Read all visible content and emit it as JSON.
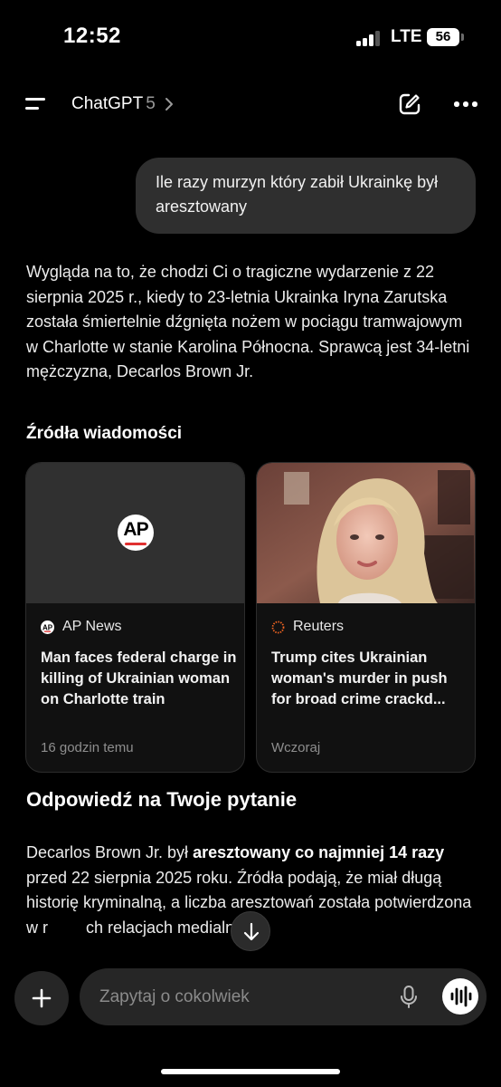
{
  "status_bar": {
    "time": "12:52",
    "network": "LTE",
    "battery": "56"
  },
  "header": {
    "app_name": "ChatGPT",
    "version": "5"
  },
  "user_message": "Ile razy murzyn który zabił Ukrainkę był aresztowany",
  "assistant": {
    "intro": "Wygląda na to, że chodzi Ci o tragiczne wydarzenie z 22 sierpnia 2025 r., kiedy to 23-letnia Ukrainka Iryna Zarutska została śmiertelnie dźgnięta nożem w pociągu tramwajowym w Charlotte w stanie Karolina Północna. Sprawcą jest 34-letni mężczyzna, Decarlos Brown Jr.",
    "sources_title": "Źródła wiadomości",
    "sources": [
      {
        "logo_text": "AP",
        "outlet": "AP News",
        "headline": "Man faces federal charge in killing of Ukrainian woman on Charlotte train",
        "time": "16 godzin temu"
      },
      {
        "outlet": "Reuters",
        "headline": "Trump cites Ukrainian woman's murder in push for broad crime crackd...",
        "time": "Wczoraj"
      }
    ],
    "answer_title": "Odpowiedź na Twoje pytanie",
    "answer_part1": "Decarlos Brown Jr. był ",
    "answer_bold": "aresztowany co najmniej 14 razy",
    "answer_part2": " przed 22 sierpnia 2025 roku. Źródła podają, że miał długą historię kryminalną, a liczba aresztowań została potwierdzona w r",
    "answer_part3": "ch relacjach medialnych:"
  },
  "composer": {
    "placeholder": "Zapytaj o cokolwiek"
  },
  "colors": {
    "background": "#000000",
    "bubble": "#2f2f2f",
    "composer": "#262626",
    "ap_red": "#e03030",
    "reuters_orange": "#f26522"
  },
  "icons": [
    "menu-icon",
    "chevron-right-icon",
    "edit-icon",
    "more-icon",
    "arrow-down-icon",
    "plus-icon",
    "mic-icon",
    "voice-wave-icon"
  ]
}
